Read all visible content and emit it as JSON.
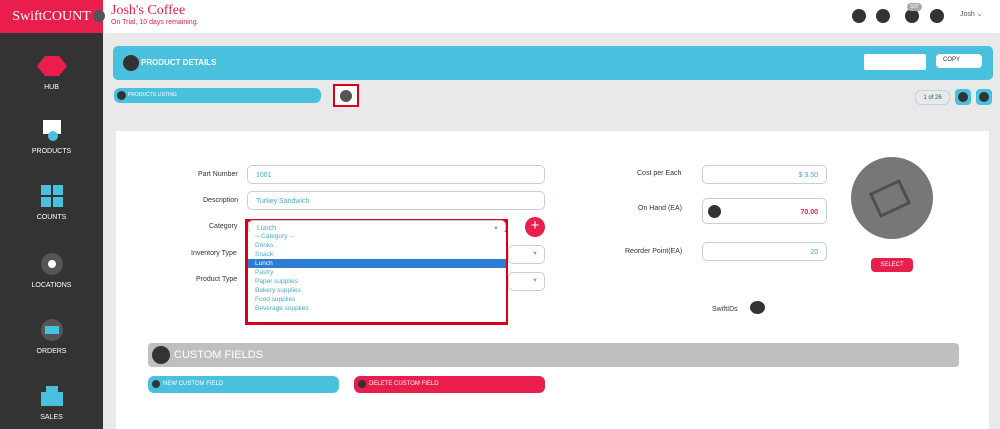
{
  "app": {
    "brand": "SwiftCOUNT",
    "company": "Josh's Coffee",
    "trial": "On Trial, 10 days remaining.",
    "user": "Josh ⌄"
  },
  "sidebar": {
    "items": [
      "HUB",
      "PRODUCTS",
      "COUNTS",
      "LOCATIONS",
      "ORDERS",
      "SALES"
    ]
  },
  "topbar": {
    "badge": "537"
  },
  "header": {
    "title": "PRODUCT DETAILS",
    "copy": "COPY"
  },
  "nav": {
    "products_listing": "PRODUCTS LISTING",
    "pager": "1 of 26"
  },
  "form": {
    "part_number_label": "Part Number",
    "part_number": "1001",
    "description_label": "Description",
    "description": "Turkey Sandwich",
    "category_label": "Category",
    "category": "Lunch",
    "inventory_type_label": "Inventory Type",
    "product_type_label": "Product Type",
    "cost_label": "Cost per Each",
    "cost": "$ 3.50",
    "on_hand_label": "On Hand (EA)",
    "on_hand": "70.00",
    "reorder_label": "Reorder Point(EA)",
    "reorder": "20",
    "select_label": "SELECT",
    "swiftids_label": "SwiftIDs"
  },
  "category_options": [
    "-- Category --",
    "Drinks",
    "Snack",
    "Lunch",
    "Pastry",
    "Paper supplies",
    "Bakery supplies",
    "Food supplies",
    "Beverage supplies"
  ],
  "custom_fields": {
    "title": "CUSTOM FIELDS",
    "new": "NEW CUSTOM FIELD",
    "delete": "DELETE CUSTOM FIELD"
  }
}
